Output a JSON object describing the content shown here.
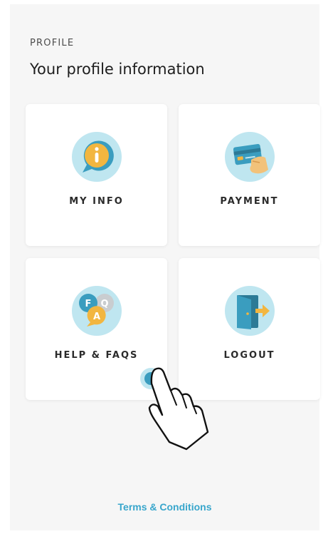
{
  "header": {
    "section_label": "PROFILE",
    "title": "Your profile information"
  },
  "cards": [
    {
      "label": "MY INFO",
      "icon": "info-icon"
    },
    {
      "label": "PAYMENT",
      "icon": "credit-card-icon"
    },
    {
      "label": "HELP & FAQS",
      "icon": "faq-bubbles-icon"
    },
    {
      "label": "LOGOUT",
      "icon": "logout-door-icon"
    }
  ],
  "footer": {
    "terms_label": "Terms & Conditions"
  },
  "colors": {
    "accent": "#38a6cc",
    "icon_circle": "#bfe6f0",
    "icon_blue": "#3a9dbf",
    "icon_yellow": "#f2b640",
    "background": "#f6f6f6",
    "card": "#ffffff"
  }
}
